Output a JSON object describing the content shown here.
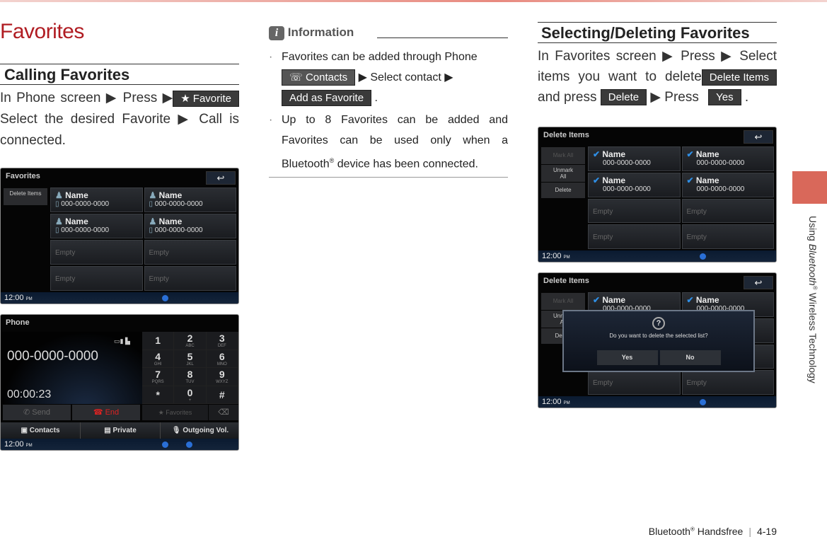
{
  "page_title": "Favorites",
  "left": {
    "heading": "Calling Favorites",
    "p1": "In Phone screen ▶ Press",
    "btn_favorite": "★ Favorite",
    "p2": "▶ Select the desired Favorite ▶ Call is connected.",
    "favorites_screen": {
      "title": "Favorites",
      "side_button": "Delete Items",
      "back_icon": "back-arrow-icon",
      "items": [
        {
          "name": "Name",
          "number": "000-0000-0000"
        },
        {
          "name": "Name",
          "number": "000-0000-0000"
        },
        {
          "name": "Name",
          "number": "000-0000-0000"
        },
        {
          "name": "Name",
          "number": "000-0000-0000"
        },
        {
          "empty": "Empty"
        },
        {
          "empty": "Empty"
        },
        {
          "empty": "Empty"
        },
        {
          "empty": "Empty"
        }
      ],
      "clock": "12:00",
      "ampm": "PM"
    },
    "phone_screen": {
      "title": "Phone",
      "number": "000-0000-0000",
      "timer": "00:00:23",
      "send": "Send",
      "end": "End",
      "keys": [
        [
          "1",
          ""
        ],
        [
          "2",
          "ABC"
        ],
        [
          "3",
          "DEF"
        ],
        [
          "4",
          "GHI"
        ],
        [
          "5",
          "JKL"
        ],
        [
          "6",
          "MNO"
        ],
        [
          "7",
          "PQRS"
        ],
        [
          "8",
          "TUV"
        ],
        [
          "9",
          "WXYZ"
        ],
        [
          "*",
          ""
        ],
        [
          "0",
          "+"
        ],
        [
          "#",
          ""
        ]
      ],
      "favorites": "Favorites",
      "contacts": "Contacts",
      "private": "Private",
      "outgoing_vol": "Outgoing Vol.",
      "clock": "12:00",
      "ampm": "PM"
    }
  },
  "info": {
    "title": "Information",
    "b1_text": "Favorites can be added through Phone",
    "btn_contacts": "Contacts",
    "b1_mid": "▶ Select contact ▶",
    "btn_add": "Add as Favorite",
    "b1_end": ".",
    "b2_pre": "Up to 8 Favorites can be added and Favorites can be used only when a Bluetooth",
    "b2_sup": "®",
    "b2_post": " device has been connected."
  },
  "right": {
    "heading": "Selecting/Deleting Favorites",
    "p1": "In Favorites screen ▶ Press",
    "btn_delete_items": "Delete Items",
    "p2": "▶ Select items you want to delete and press",
    "btn_delete": "Delete",
    "p3": "▶ Press",
    "btn_yes": "Yes",
    "p4": ".",
    "delete_screen": {
      "title": "Delete Items",
      "mark_all": "Mark All",
      "unmark_all": "Unmark All",
      "delete": "Delete",
      "clock": "12:00",
      "ampm": "PM",
      "items": [
        {
          "name": "Name",
          "number": "000-0000-0000"
        },
        {
          "name": "Name",
          "number": "000-0000-0000"
        },
        {
          "name": "Name",
          "number": "000-0000-0000"
        },
        {
          "name": "Name",
          "number": "000-0000-0000"
        },
        {
          "empty": "Empty"
        },
        {
          "empty": "Empty"
        },
        {
          "empty": "Empty"
        },
        {
          "empty": "Empty"
        }
      ]
    },
    "dialog": {
      "question": "Do you want to delete the selected list?",
      "yes": "Yes",
      "no": "No"
    }
  },
  "side_tab": {
    "pre": "Using ",
    "italic": "Bluetooth",
    "sup": "®",
    "post": " Wireless Technology",
    "color": "#d9685a"
  },
  "footer": {
    "section": "Bluetooth",
    "sup": "®",
    "section_post": " Handsfree",
    "page": "4-19"
  },
  "colors": {
    "title": "#b01c22",
    "check": "#2f8fe6"
  }
}
